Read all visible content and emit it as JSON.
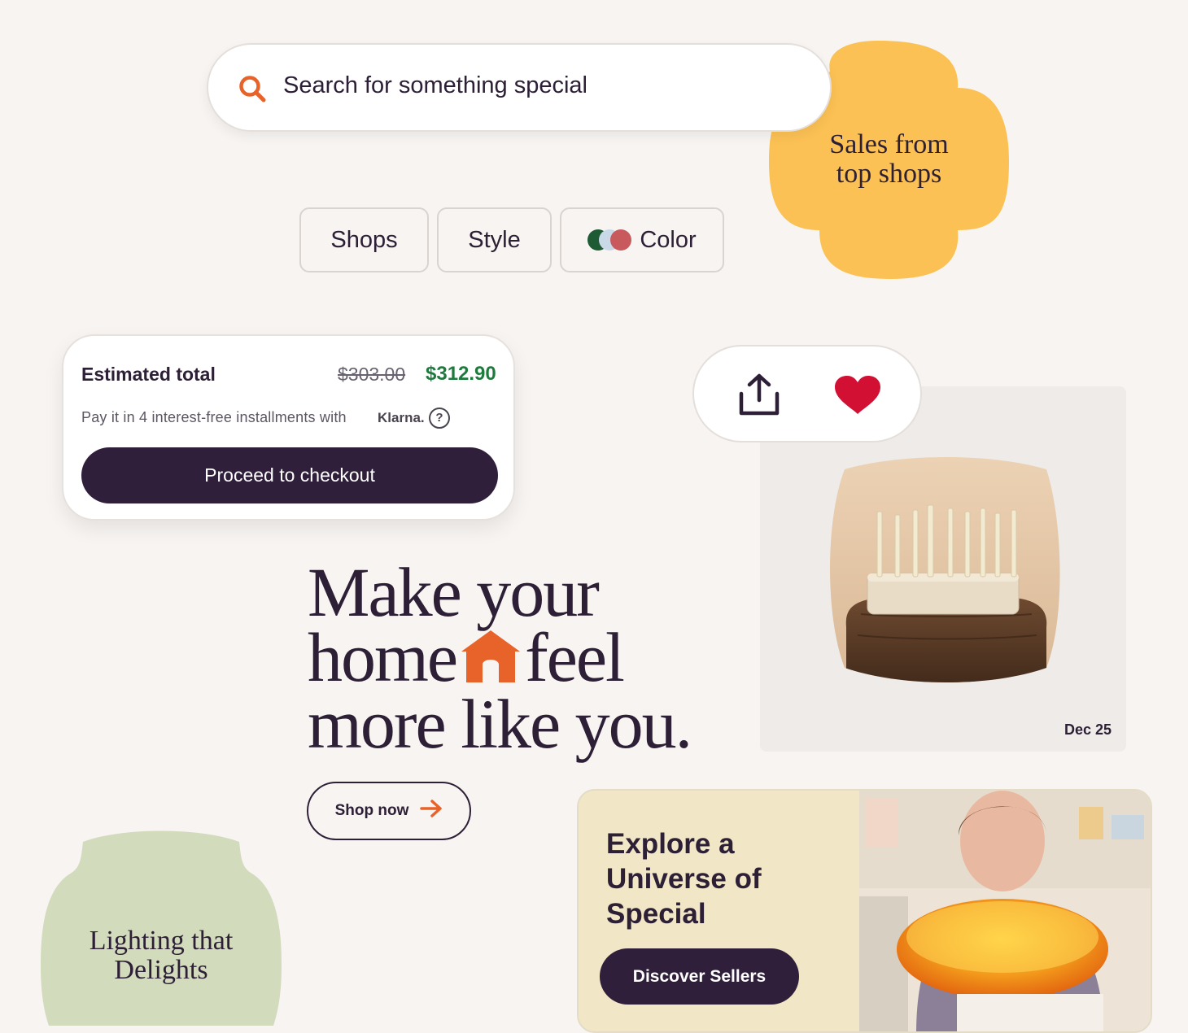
{
  "search": {
    "placeholder": "Search for something special"
  },
  "promo_yellow": {
    "label_line1": "Sales from",
    "label_line2": "top shops"
  },
  "filters": {
    "shops": "Shops",
    "style": "Style",
    "color": "Color"
  },
  "checkout": {
    "estimated_label": "Estimated total",
    "original_price": "$303.00",
    "sale_price": "$312.90",
    "installments_text": "Pay it in 4 interest-free installments with",
    "klarna": "Klarna.",
    "help": "?",
    "button": "Proceed to checkout"
  },
  "product": {
    "date": "Dec 25"
  },
  "hero": {
    "line1": "Make your",
    "line2a": "home",
    "line2b": "feel",
    "line3": "more like you.",
    "cta": "Shop now"
  },
  "promo_green": {
    "label_line1": "Lighting that",
    "label_line2": "Delights"
  },
  "explore": {
    "title": "Explore a Universe of Special",
    "button": "Discover Sellers"
  },
  "colors": {
    "accent_orange": "#e8632a",
    "dark_plum": "#2f1f3b",
    "price_green": "#1f7a3e",
    "yellow": "#fbc154",
    "sage": "#d3dbbd",
    "heart_red": "#d21034"
  }
}
